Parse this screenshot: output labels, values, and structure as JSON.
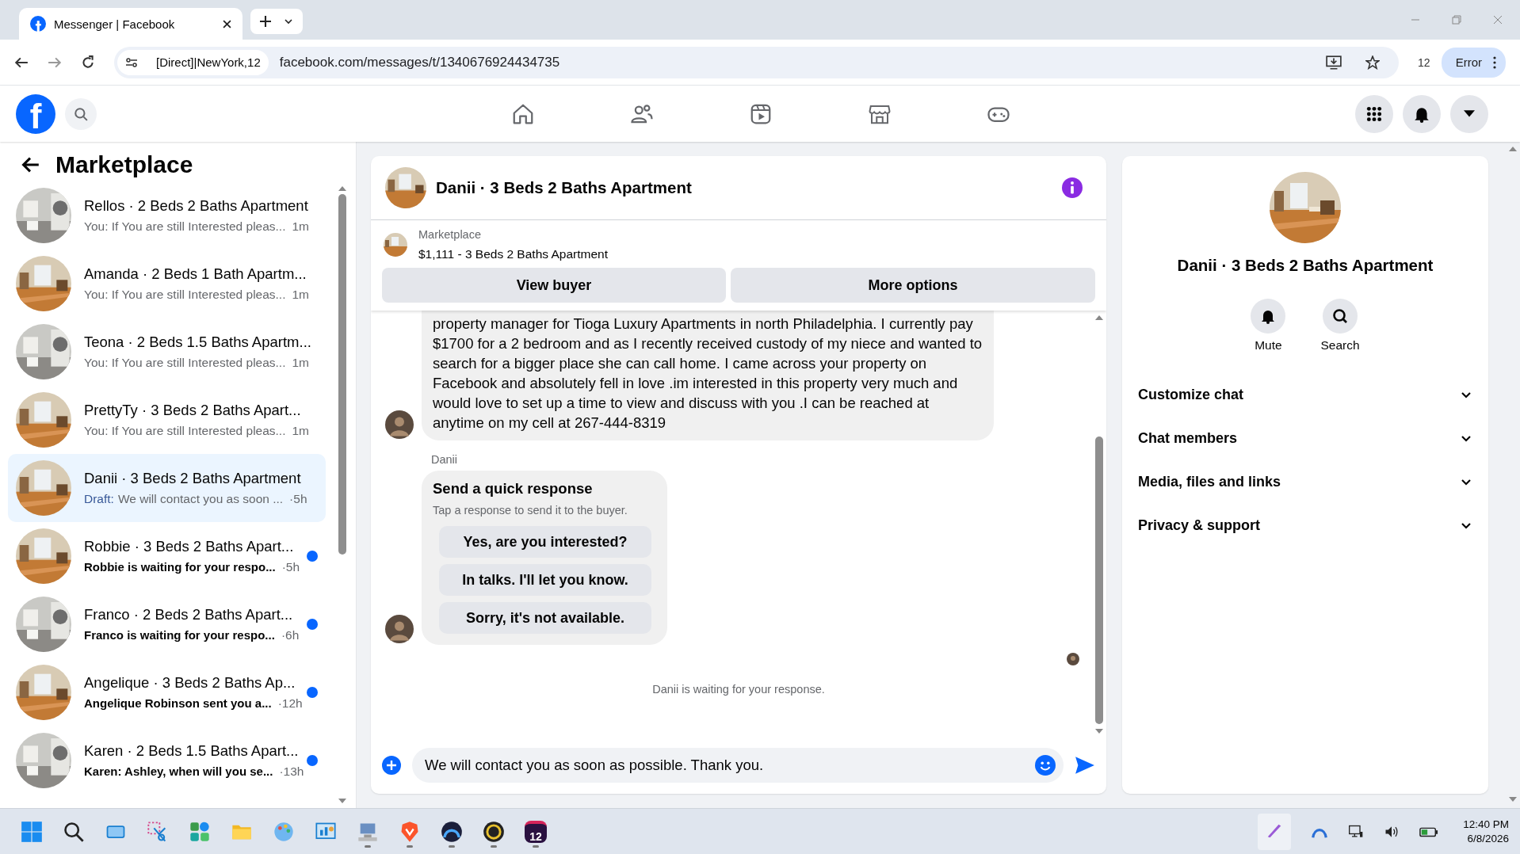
{
  "browser": {
    "tab_title": "Messenger | Facebook",
    "proxy_chip": "[Direct]|NewYork,12",
    "url": "facebook.com/messages/t/1340676924434735",
    "extension_count": "12",
    "profile_button": "Error"
  },
  "header": {
    "logo": "f"
  },
  "sidebar": {
    "title": "Marketplace",
    "conversations": [
      {
        "name": "Rellos · 2 Beds 2 Baths Apartment",
        "preview": "You: If You are still Interested pleas...",
        "time": "1m",
        "selected": false,
        "unread": false
      },
      {
        "name": "Amanda · 2 Beds 1 Bath Apartm...",
        "preview": "You: If You are still Interested pleas...",
        "time": "1m",
        "selected": false,
        "unread": false
      },
      {
        "name": "Teona · 2 Beds 1.5 Baths Apartm...",
        "preview": "You: If You are still Interested pleas...",
        "time": "1m",
        "selected": false,
        "unread": false
      },
      {
        "name": "PrettyTy · 3 Beds 2 Baths Apart...",
        "preview": "You: If You are still Interested pleas...",
        "time": "1m",
        "selected": false,
        "unread": false
      },
      {
        "name": "Danii · 3 Beds 2 Baths Apartment",
        "draft_label": "Draft:",
        "preview": "We will contact you as soon ...",
        "time": "·5h",
        "selected": true,
        "unread": false
      },
      {
        "name": "Robbie · 3 Beds 2 Baths Apart...",
        "preview": "Robbie is waiting for your respo...",
        "time": "·5h",
        "selected": false,
        "unread": true
      },
      {
        "name": "Franco · 2 Beds 2 Baths Apart...",
        "preview": "Franco is waiting for your respo...",
        "time": "·6h",
        "selected": false,
        "unread": true
      },
      {
        "name": "Angelique · 3 Beds 2 Baths Ap...",
        "preview": "Angelique Robinson sent you a...",
        "time": "·12h",
        "selected": false,
        "unread": true
      },
      {
        "name": "Karen · 2 Beds 1.5 Baths Apart...",
        "preview": "Karen: Ashley, when will you se...",
        "time": "·13h",
        "selected": false,
        "unread": true
      }
    ]
  },
  "chat": {
    "title": "Danii · 3 Beds 2 Baths Apartment",
    "listing_source": "Marketplace",
    "listing_title": "$1,111 - 3 Beds 2 Baths Apartment",
    "buttons": [
      "View buyer",
      "More options"
    ],
    "message": "property manager for Tioga Luxury Apartments in north Philadelphia. I currently pay $1700 for a 2 bedroom and as I recently received custody of my niece and wanted to search for a bigger place she can call home. I came across your property on Facebook and absolutely fell in love .im interested in this property very much and would love to set up a time to view and discuss with you .I can be reached at anytime on my cell at 267-444-8319",
    "sender": "Danii",
    "quick_response": {
      "title": "Send a quick response",
      "subtitle": "Tap a response to send it to the buyer.",
      "options": [
        "Yes, are you interested?",
        "In talks. I'll let you know.",
        "Sorry, it's not available."
      ]
    },
    "status": "Danii is waiting for your response.",
    "composer": {
      "value": "We will contact you as soon as possible. Thank you."
    }
  },
  "info_panel": {
    "title": "Danii · 3 Beds 2 Baths Apartment",
    "actions": [
      "Mute",
      "Search"
    ],
    "sections": [
      {
        "label": "Customize chat",
        "expanded": false
      },
      {
        "label": "Chat members",
        "expanded": false
      },
      {
        "label": "Media, files and links",
        "expanded": false
      },
      {
        "label": "Privacy & support",
        "expanded": false
      }
    ]
  },
  "taskbar": {
    "badge": "12",
    "time": "12:40 PM",
    "date": "6/8/2026"
  }
}
